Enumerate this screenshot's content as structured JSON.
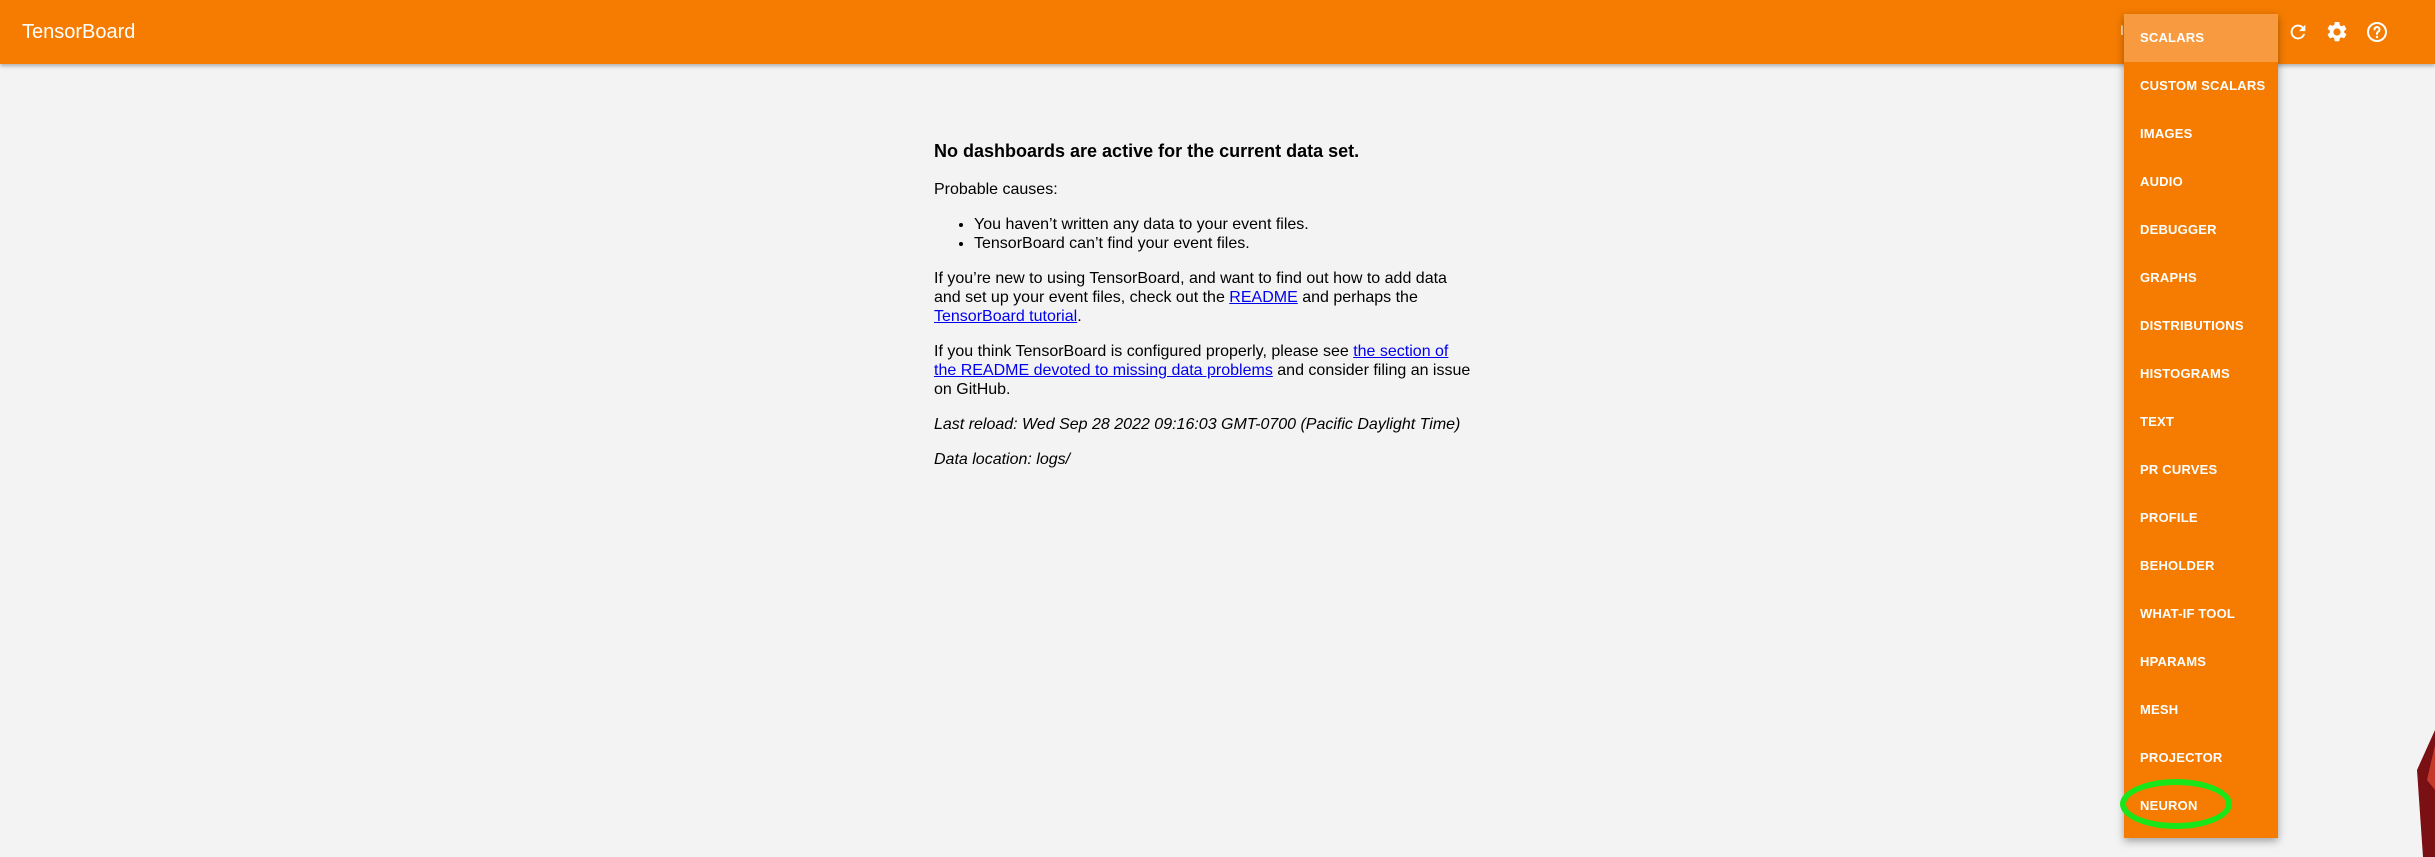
{
  "app": {
    "title": "TensorBoard"
  },
  "header": {
    "hidden_label": "I",
    "icons": [
      "refresh-icon",
      "settings-icon",
      "help-icon"
    ]
  },
  "main": {
    "heading": "No dashboards are active for the current data set.",
    "probable_causes": "Probable causes:",
    "causes": [
      "You haven’t written any data to your event files.",
      "TensorBoard can’t find your event files."
    ],
    "para1_before": "If you’re new to using TensorBoard, and want to find out how to add data and set up your event files, check out the ",
    "readme_link": "README",
    "para1_middle": " and perhaps the ",
    "tutorial_link": "TensorBoard tutorial",
    "para1_after": ".",
    "para2_before": "If you think TensorBoard is configured properly, please see ",
    "section_link": "the section of the README devoted to missing data problems",
    "para2_after": " and consider filing an issue on GitHub.",
    "last_reload": "Last reload: Wed Sep 28 2022 09:16:03 GMT-0700 (Pacific Daylight Time)",
    "data_location": "Data location: logs/"
  },
  "dropdown": {
    "selected": "SCALARS",
    "items": [
      "SCALARS",
      "CUSTOM SCALARS",
      "IMAGES",
      "AUDIO",
      "DEBUGGER",
      "GRAPHS",
      "DISTRIBUTIONS",
      "HISTOGRAMS",
      "TEXT",
      "PR CURVES",
      "PROFILE",
      "BEHOLDER",
      "WHAT-IF TOOL",
      "HPARAMS",
      "MESH",
      "PROJECTOR",
      "NEURON"
    ]
  },
  "colors": {
    "brand": "#f57c00",
    "selected": "#f79a40",
    "highlight": "#19e619",
    "background": "#f3f3f3",
    "link": "#0000ee"
  }
}
